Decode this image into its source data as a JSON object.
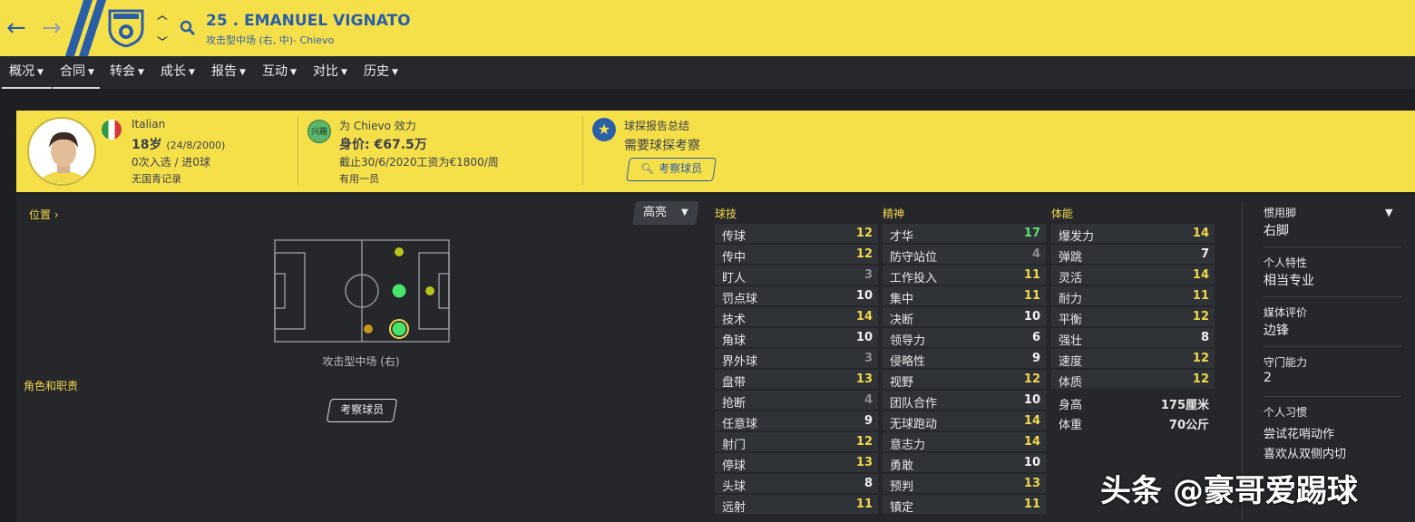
{
  "header": {
    "title": "25 . EMANUEL VIGNATO",
    "subtitle": "攻击型中场 (右, 中)- Chievo"
  },
  "nav": [
    {
      "label": "概况"
    },
    {
      "label": "合同"
    },
    {
      "label": "转会"
    },
    {
      "label": "成长"
    },
    {
      "label": "报告"
    },
    {
      "label": "互动"
    },
    {
      "label": "对比"
    },
    {
      "label": "历史"
    }
  ],
  "card": {
    "nationality": "Italian",
    "age": "18岁",
    "dob": "(24/8/2000)",
    "caps": "0次入选 / 进0球",
    "youth": "无国青记录",
    "club_line": "为 Chievo 效力",
    "interest_badge": "兴趣",
    "value": "身价: €67.5万",
    "contract": "截止30/6/2020工资为€1800/周",
    "squad_status": "有用一员",
    "scout_title": "球探报告总结",
    "scout_need": "需要球探考察",
    "scout_button": "考察球员"
  },
  "left": {
    "position_link": "位置",
    "highlight": "高亮",
    "position_name": "攻击型中场 (右)",
    "role_label": "角色和职责",
    "scout_button": "考察球员"
  },
  "attributes": {
    "technical_title": "球技",
    "mental_title": "精神",
    "physical_title": "体能",
    "technical": [
      {
        "label": "传球",
        "value": "12",
        "tone": "y"
      },
      {
        "label": "传中",
        "value": "12",
        "tone": "y"
      },
      {
        "label": "盯人",
        "value": "3",
        "tone": "g"
      },
      {
        "label": "罚点球",
        "value": "10",
        "tone": "w"
      },
      {
        "label": "技术",
        "value": "14",
        "tone": "y"
      },
      {
        "label": "角球",
        "value": "10",
        "tone": "w"
      },
      {
        "label": "界外球",
        "value": "3",
        "tone": "g"
      },
      {
        "label": "盘带",
        "value": "13",
        "tone": "y"
      },
      {
        "label": "抢断",
        "value": "4",
        "tone": "g"
      },
      {
        "label": "任意球",
        "value": "9",
        "tone": "w"
      },
      {
        "label": "射门",
        "value": "12",
        "tone": "y"
      },
      {
        "label": "停球",
        "value": "13",
        "tone": "y"
      },
      {
        "label": "头球",
        "value": "8",
        "tone": "w"
      },
      {
        "label": "远射",
        "value": "11",
        "tone": "y"
      }
    ],
    "mental": [
      {
        "label": "才华",
        "value": "17",
        "tone": "gr"
      },
      {
        "label": "防守站位",
        "value": "4",
        "tone": "g"
      },
      {
        "label": "工作投入",
        "value": "11",
        "tone": "y"
      },
      {
        "label": "集中",
        "value": "11",
        "tone": "y"
      },
      {
        "label": "决断",
        "value": "10",
        "tone": "w"
      },
      {
        "label": "领导力",
        "value": "6",
        "tone": "w"
      },
      {
        "label": "侵略性",
        "value": "9",
        "tone": "w"
      },
      {
        "label": "视野",
        "value": "12",
        "tone": "y"
      },
      {
        "label": "团队合作",
        "value": "10",
        "tone": "w"
      },
      {
        "label": "无球跑动",
        "value": "14",
        "tone": "y"
      },
      {
        "label": "意志力",
        "value": "14",
        "tone": "y"
      },
      {
        "label": "勇敢",
        "value": "10",
        "tone": "w"
      },
      {
        "label": "预判",
        "value": "13",
        "tone": "y"
      },
      {
        "label": "镇定",
        "value": "11",
        "tone": "y"
      }
    ],
    "physical": [
      {
        "label": "爆发力",
        "value": "14",
        "tone": "y"
      },
      {
        "label": "弹跳",
        "value": "7",
        "tone": "w"
      },
      {
        "label": "灵活",
        "value": "14",
        "tone": "y"
      },
      {
        "label": "耐力",
        "value": "11",
        "tone": "y"
      },
      {
        "label": "平衡",
        "value": "12",
        "tone": "y"
      },
      {
        "label": "强壮",
        "value": "8",
        "tone": "w"
      },
      {
        "label": "速度",
        "value": "12",
        "tone": "y"
      },
      {
        "label": "体质",
        "value": "12",
        "tone": "y"
      }
    ],
    "height_label": "身高",
    "height": "175厘米",
    "weight_label": "体重",
    "weight": "70公斤"
  },
  "right_panel": {
    "foot_label": "惯用脚",
    "foot": "右脚",
    "trait_label": "个人特性",
    "trait": "相当专业",
    "media_label": "媒体评价",
    "media": "边锋",
    "gk_label": "守门能力",
    "gk": "2",
    "habit_label": "个人习惯",
    "habit1": "尝试花哨动作",
    "habit2": "喜欢从双侧内切"
  },
  "watermark": "头条 @豪哥爱踢球",
  "colors": {
    "yellow": "#f6e04a",
    "blue": "#2a5fa8",
    "green": "#46e46a",
    "amber": "#c8941c",
    "olive": "#b8c41e"
  }
}
